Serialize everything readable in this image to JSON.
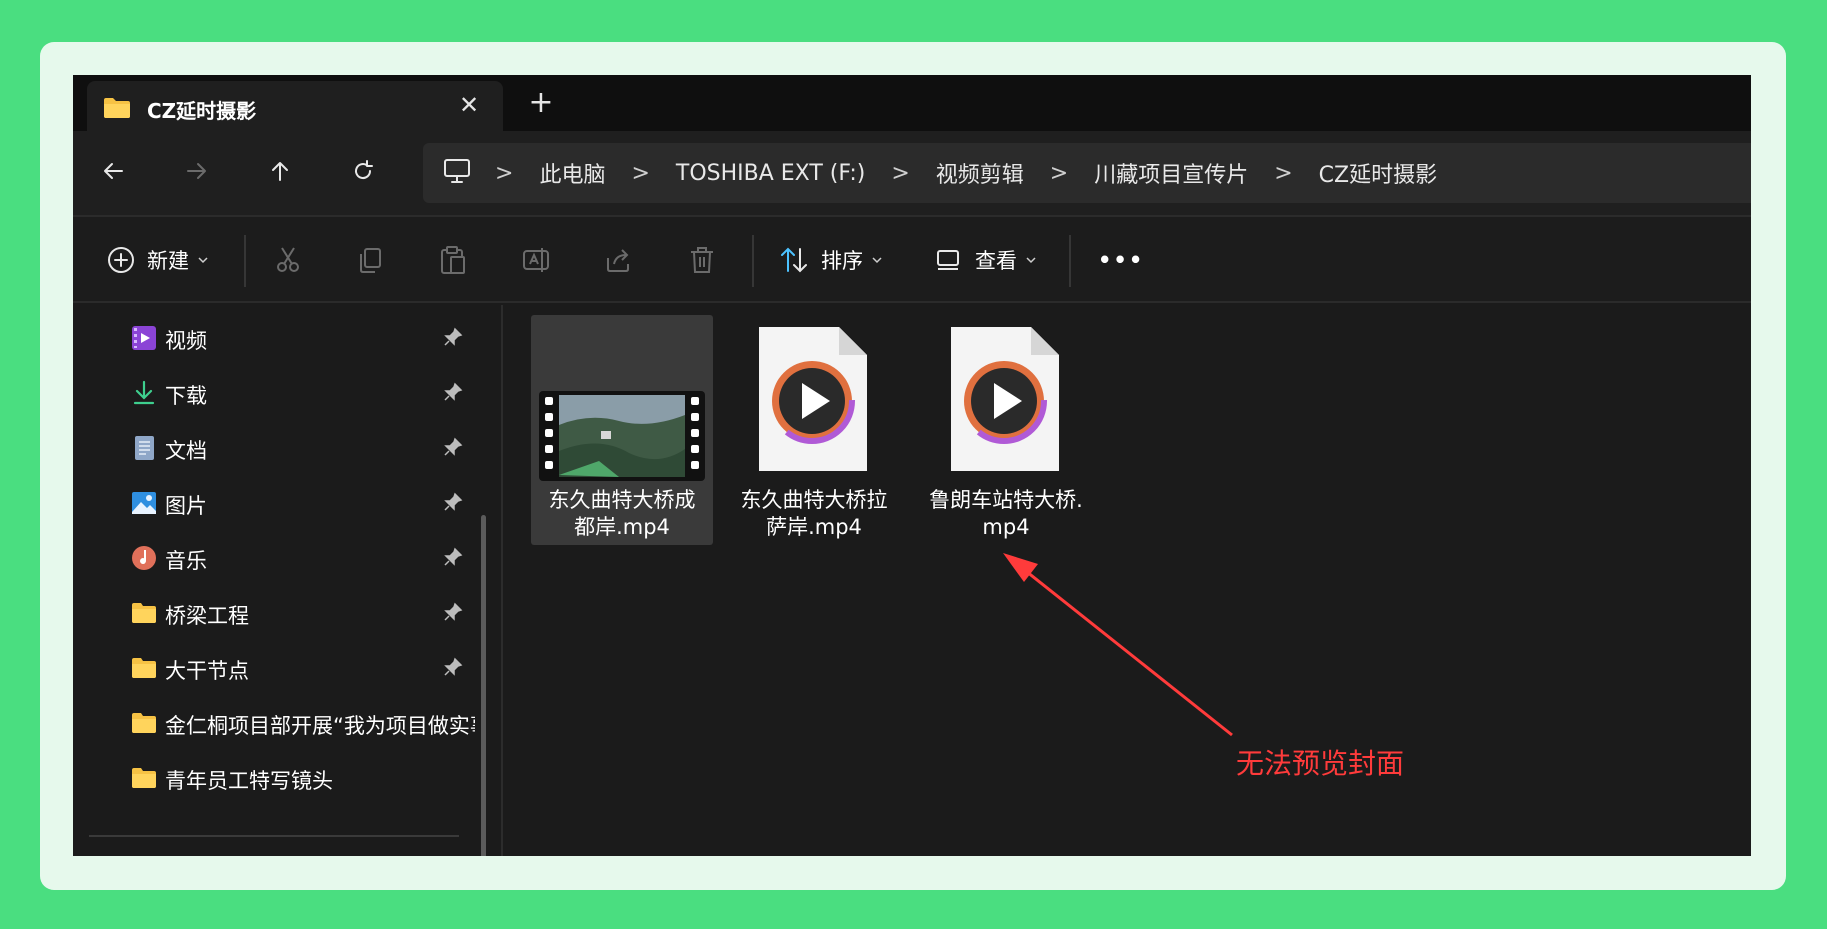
{
  "window": {
    "tab_title": "CZ延时摄影",
    "tab_close": "✕",
    "new_tab": "+"
  },
  "nav": {
    "breadcrumbs": [
      "此电脑",
      "TOSHIBA EXT (F:)",
      "视频剪辑",
      "川藏项目宣传片",
      "CZ延时摄影"
    ],
    "separator": ">"
  },
  "toolbar": {
    "new_label": "新建",
    "sort_label": "排序",
    "view_label": "查看",
    "more_label": "•••"
  },
  "sidebar": {
    "items": [
      {
        "label": "视频",
        "icon": "video-library-icon",
        "pinned": true
      },
      {
        "label": "下载",
        "icon": "download-icon",
        "pinned": true
      },
      {
        "label": "文档",
        "icon": "document-icon",
        "pinned": true
      },
      {
        "label": "图片",
        "icon": "pictures-icon",
        "pinned": true
      },
      {
        "label": "音乐",
        "icon": "music-icon",
        "pinned": true
      },
      {
        "label": "桥梁工程",
        "icon": "folder-icon",
        "pinned": true
      },
      {
        "label": "大干节点",
        "icon": "folder-icon",
        "pinned": true
      },
      {
        "label": "金仁桐项目部开展“我为项目做实事",
        "icon": "folder-icon",
        "pinned": false
      },
      {
        "label": "青年员工特写镜头",
        "icon": "folder-icon",
        "pinned": false
      }
    ]
  },
  "files": [
    {
      "name": "东久曲特大桥成都岸.mp4",
      "line1": "东久曲特大桥成",
      "line2": "都岸.mp4",
      "thumbnail": "video-thumbnail",
      "selected": true
    },
    {
      "name": "东久曲特大桥拉萨岸.mp4",
      "line1": "东久曲特大桥拉",
      "line2": "萨岸.mp4",
      "thumbnail": "media-player-icon",
      "selected": false
    },
    {
      "name": "鲁朗车站特大桥.mp4",
      "line1": "鲁朗车站特大桥.",
      "line2": "mp4",
      "thumbnail": "media-player-icon",
      "selected": false
    }
  ],
  "annotation": {
    "text": "无法预览封面",
    "color": "#ff3b3b"
  },
  "colors": {
    "background": "#4ade80",
    "window": "#1b1b1b",
    "folder": "#f6c244"
  }
}
